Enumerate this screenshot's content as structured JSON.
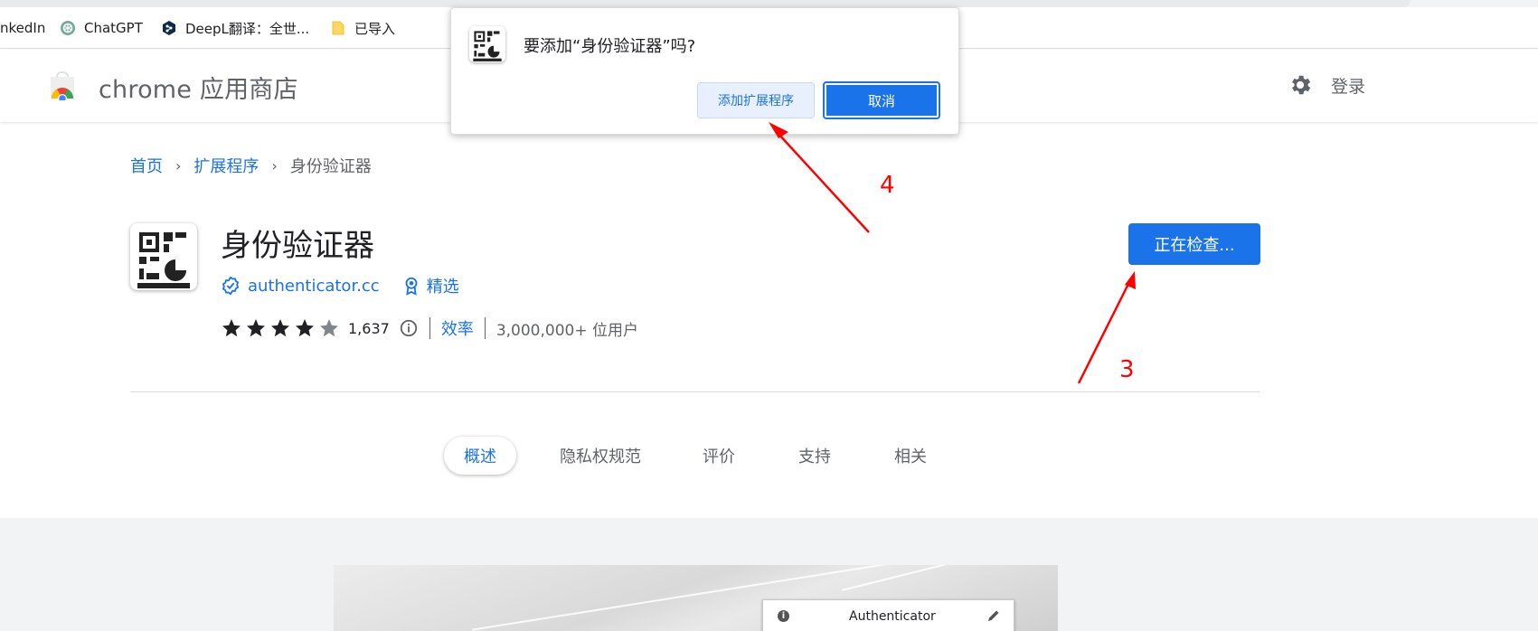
{
  "bookmarks": [
    {
      "label": "nkedIn",
      "icon": "linkedin-icon"
    },
    {
      "label": "ChatGPT",
      "icon": "chatgpt-icon"
    },
    {
      "label": "DeepL翻译：全世...",
      "icon": "deepl-icon"
    },
    {
      "label": "已导入",
      "icon": "folder-icon"
    }
  ],
  "header": {
    "title": "chrome 应用商店",
    "login": "登录",
    "settings_icon": "gear-icon"
  },
  "breadcrumb": {
    "home": "首页",
    "extensions": "扩展程序",
    "current": "身份验证器"
  },
  "extension": {
    "name": "身份验证器",
    "publisher": "authenticator.cc",
    "featured": "精选",
    "rating": 4.5,
    "rating_count": "1,637",
    "category": "效率",
    "users": "3,000,000+ 位用户",
    "action_button": "正在检查..."
  },
  "tabs": [
    {
      "label": "概述",
      "active": true
    },
    {
      "label": "隐私权规范",
      "active": false
    },
    {
      "label": "评价",
      "active": false
    },
    {
      "label": "支持",
      "active": false
    },
    {
      "label": "相关",
      "active": false
    }
  ],
  "screenshot": {
    "app_title": "Authenticator"
  },
  "dialog": {
    "title": "要添加“身份验证器”吗?",
    "add_button": "添加扩展程序",
    "cancel_button": "取消"
  },
  "annotations": {
    "step_3": "3",
    "step_4": "4",
    "color": "#ff0000"
  },
  "colors": {
    "accent": "#1a73e8",
    "text": "#202124",
    "muted": "#5f6368"
  }
}
